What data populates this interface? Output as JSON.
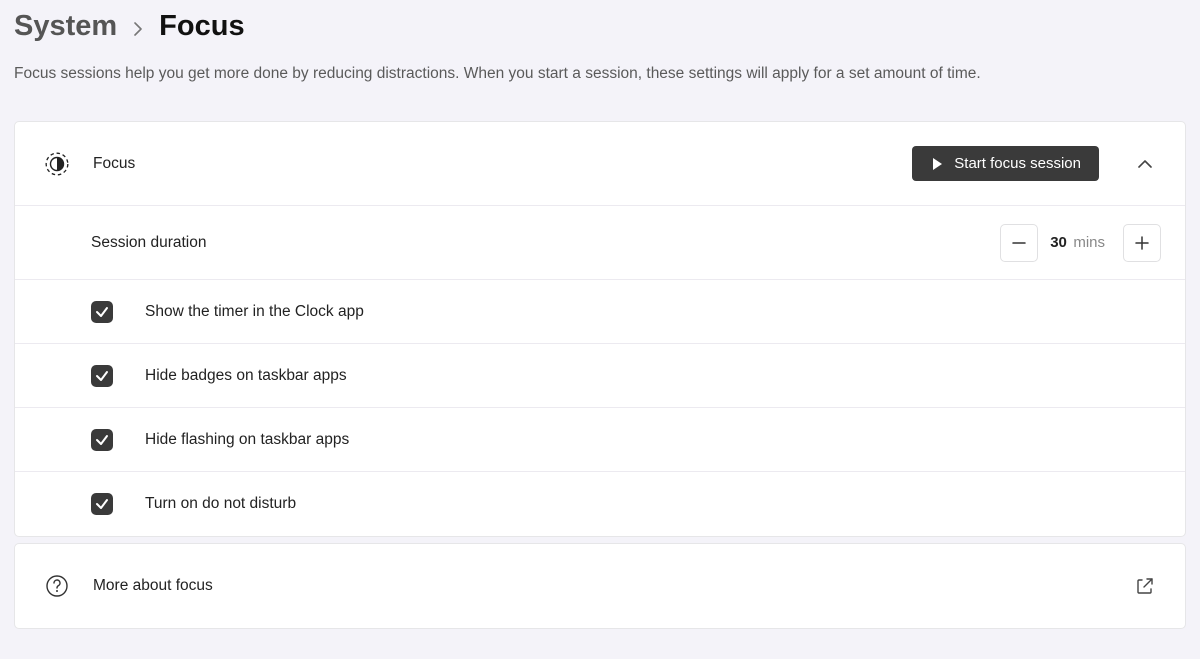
{
  "breadcrumb": {
    "parent": "System",
    "current": "Focus"
  },
  "description": "Focus sessions help you get more done by reducing distractions. When you start a session, these settings will apply for a set amount of time.",
  "focus": {
    "title": "Focus",
    "start_button": "Start focus session",
    "session_duration_label": "Session duration",
    "duration_value": "30",
    "duration_unit": "mins",
    "options": {
      "show_timer": "Show the timer in the Clock app",
      "hide_badges": "Hide badges on taskbar apps",
      "hide_flashing": "Hide flashing on taskbar apps",
      "dnd": "Turn on do not disturb"
    }
  },
  "more": {
    "label": "More about focus"
  }
}
